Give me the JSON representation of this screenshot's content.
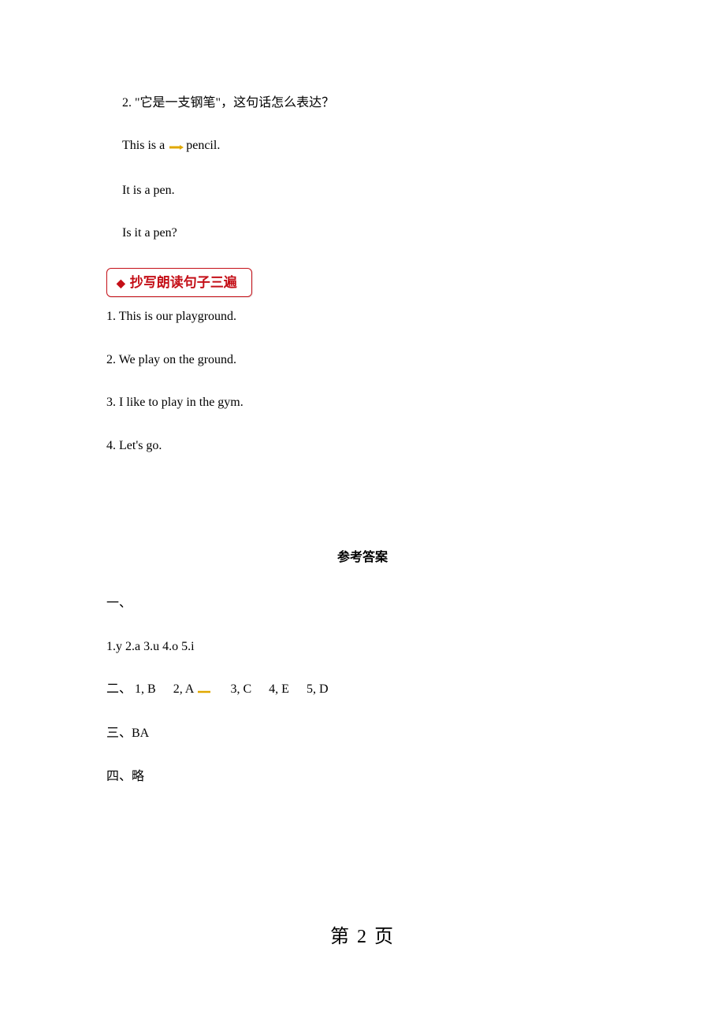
{
  "question2": {
    "text": "2.   \"它是一支钢笔\"，这句话怎么表达？",
    "options": [
      "This is a ",
      "It is a pen.",
      "Is it a pen?"
    ],
    "opt0_tail": "pencil."
  },
  "badge": {
    "diamond": "◆",
    "label": "抄写朗读句子三遍"
  },
  "copy_sentences": [
    "1. This is our playground.",
    "2. We play on the ground.",
    "3. I like to play in the gym.",
    "4. Let's go."
  ],
  "answers": {
    "title": "参考答案",
    "one_label": "一、",
    "one_content": "1.y 2.a 3.u 4.o 5.i",
    "two_label": "二、",
    "two_items": [
      "1, B",
      "2, A",
      "3, C",
      "4, E",
      "5, D"
    ],
    "three": "三、BA",
    "four": "四、略"
  },
  "page_footer": "第 2 页"
}
